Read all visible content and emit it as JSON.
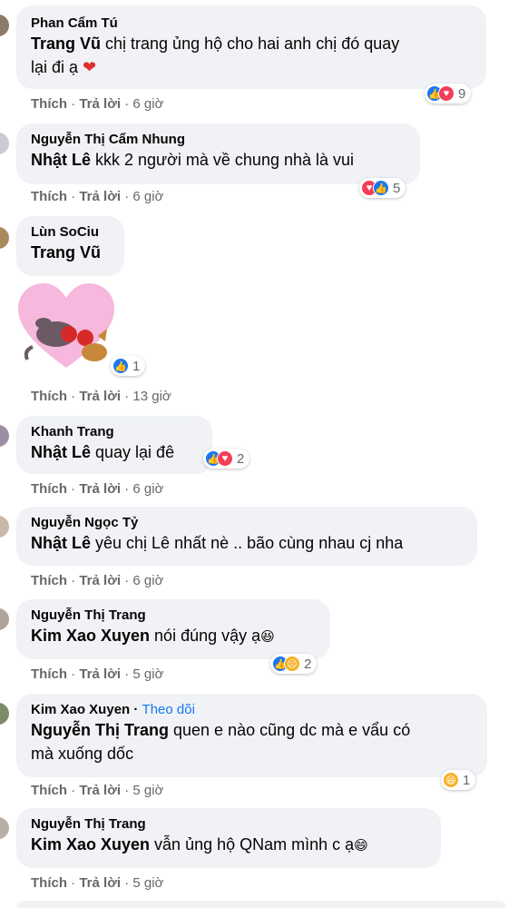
{
  "comments": [
    {
      "author": "Phan Cẩm Tú",
      "mention": "Trang Vũ",
      "text_line1": " chị trang ủng hộ cho hai anh chị đó quay",
      "text_line2": "lại đi ạ",
      "emoji": "❤",
      "actions": {
        "like": "Thích",
        "reply": "Trả lời",
        "time": "6 giờ"
      },
      "reactions": {
        "icons": [
          "like",
          "love"
        ],
        "count": "9"
      }
    },
    {
      "author": "Nguyễn Thị Cẩm Nhung",
      "mention": "Nhật Lê",
      "text": " kkk 2 người mà về chung nhà là vui",
      "actions": {
        "like": "Thích",
        "reply": "Trả lời",
        "time": "6 giờ"
      },
      "reactions": {
        "icons": [
          "love",
          "like"
        ],
        "count": "5"
      }
    },
    {
      "author": "Lùn SoCiu",
      "mention": "Trang Vũ",
      "sticker": "heart-cat-sticker",
      "actions": {
        "like": "Thích",
        "reply": "Trả lời",
        "time": "13 giờ"
      },
      "reactions": {
        "icons": [
          "like"
        ],
        "count": "1"
      }
    },
    {
      "author": "Khanh Trang",
      "mention": "Nhật Lê",
      "text": " quay lại đê",
      "actions": {
        "like": "Thích",
        "reply": "Trả lời",
        "time": "6 giờ"
      },
      "reactions": {
        "icons": [
          "like",
          "love"
        ],
        "count": "2"
      }
    },
    {
      "author": "Nguyễn Ngọc Tỷ",
      "mention": "Nhật Lê",
      "text": " yêu chị Lê nhất nè .. bão cùng nhau cj nha",
      "actions": {
        "like": "Thích",
        "reply": "Trả lời",
        "time": "6 giờ"
      }
    },
    {
      "author": "Nguyễn Thị Trang",
      "mention": "Kim Xao Xuyen",
      "text": " nói đúng vậy ạ",
      "emoji": "😆",
      "actions": {
        "like": "Thích",
        "reply": "Trả lời",
        "time": "5 giờ"
      },
      "reactions": {
        "icons": [
          "like",
          "sad"
        ],
        "count": "2"
      }
    },
    {
      "author": "Kim Xao Xuyen",
      "follow": "Theo dõi",
      "mention": "Nguyễn Thị Trang",
      "text_line1": " quen e nào cũng dc mà e vẩu có",
      "text_line2": "mà xuống dốc",
      "actions": {
        "like": "Thích",
        "reply": "Trả lời",
        "time": "5 giờ"
      },
      "reactions": {
        "icons": [
          "haha"
        ],
        "count": "1"
      }
    },
    {
      "author": "Nguyễn Thị Trang",
      "mention": "Kim Xao Xuyen",
      "text": " vẫn ủng hộ QNam mình c ạ",
      "emoji": "😄",
      "actions": {
        "like": "Thích",
        "reply": "Trả lời",
        "time": "5 giờ"
      }
    }
  ],
  "separator": " · ",
  "colors": {
    "bubble": "#f0f2f5",
    "meta": "#65676b",
    "like": "#1877f2",
    "love": "#f33e58",
    "follow": "#1877f2"
  }
}
